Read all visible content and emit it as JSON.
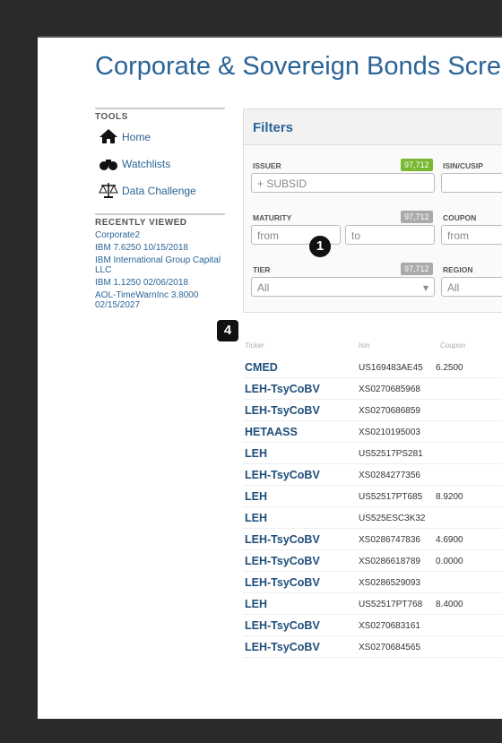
{
  "page": {
    "title": "Corporate & Sovereign Bonds Scree"
  },
  "sidebar": {
    "tools_heading": "TOOLS",
    "tools": [
      {
        "label": "Home",
        "icon": "home-icon"
      },
      {
        "label": "Watchlists",
        "icon": "binoculars-icon"
      },
      {
        "label": "Data Challenge",
        "icon": "scales-icon"
      }
    ],
    "recent_heading": "RECENTLY VIEWED",
    "recent": [
      "Corporate2",
      "IBM 7.6250 10/15/2018",
      "IBM International Group Capital LLC",
      "IBM 1.1250 02/06/2018",
      "AOL-TimeWarnInc 3.8000 02/15/2027"
    ]
  },
  "filters": {
    "heading": "Filters",
    "issuer": {
      "label": "ISSUER",
      "count": "97,712",
      "value": "+ SUBSID"
    },
    "isin": {
      "label": "ISIN/CUSIP"
    },
    "maturity": {
      "label": "MATURITY",
      "count": "97,712",
      "from": "from",
      "to": "to"
    },
    "coupon": {
      "label": "COUPON",
      "from": "from"
    },
    "tier": {
      "label": "TIER",
      "count": "97,712",
      "value": "All"
    },
    "region": {
      "label": "REGION",
      "value": "All"
    },
    "badge_colors": {
      "green": "#7ab833",
      "gray": "#aaaaaa"
    }
  },
  "markers": {
    "one": "1",
    "four": "4"
  },
  "table": {
    "columns": [
      "Ticker",
      "Isin",
      "Coupon"
    ],
    "rows": [
      {
        "ticker": "CMED",
        "isin": "US169483AE45",
        "coupon": "6.2500"
      },
      {
        "ticker": "LEH-TsyCoBV",
        "isin": "XS0270685968",
        "coupon": ""
      },
      {
        "ticker": "LEH-TsyCoBV",
        "isin": "XS0270686859",
        "coupon": ""
      },
      {
        "ticker": "HETAASS",
        "isin": "XS0210195003",
        "coupon": ""
      },
      {
        "ticker": "LEH",
        "isin": "US52517PS281",
        "coupon": ""
      },
      {
        "ticker": "LEH-TsyCoBV",
        "isin": "XS0284277356",
        "coupon": ""
      },
      {
        "ticker": "LEH",
        "isin": "US52517PT685",
        "coupon": "8.9200"
      },
      {
        "ticker": "LEH",
        "isin": "US525ESC3K32",
        "coupon": ""
      },
      {
        "ticker": "LEH-TsyCoBV",
        "isin": "XS0286747836",
        "coupon": "4.6900"
      },
      {
        "ticker": "LEH-TsyCoBV",
        "isin": "XS0286618789",
        "coupon": "0.0000"
      },
      {
        "ticker": "LEH-TsyCoBV",
        "isin": "XS0286529093",
        "coupon": ""
      },
      {
        "ticker": "LEH",
        "isin": "US52517PT768",
        "coupon": "8.4000"
      },
      {
        "ticker": "LEH-TsyCoBV",
        "isin": "XS0270683161",
        "coupon": ""
      },
      {
        "ticker": "LEH-TsyCoBV",
        "isin": "XS0270684565",
        "coupon": ""
      }
    ]
  }
}
